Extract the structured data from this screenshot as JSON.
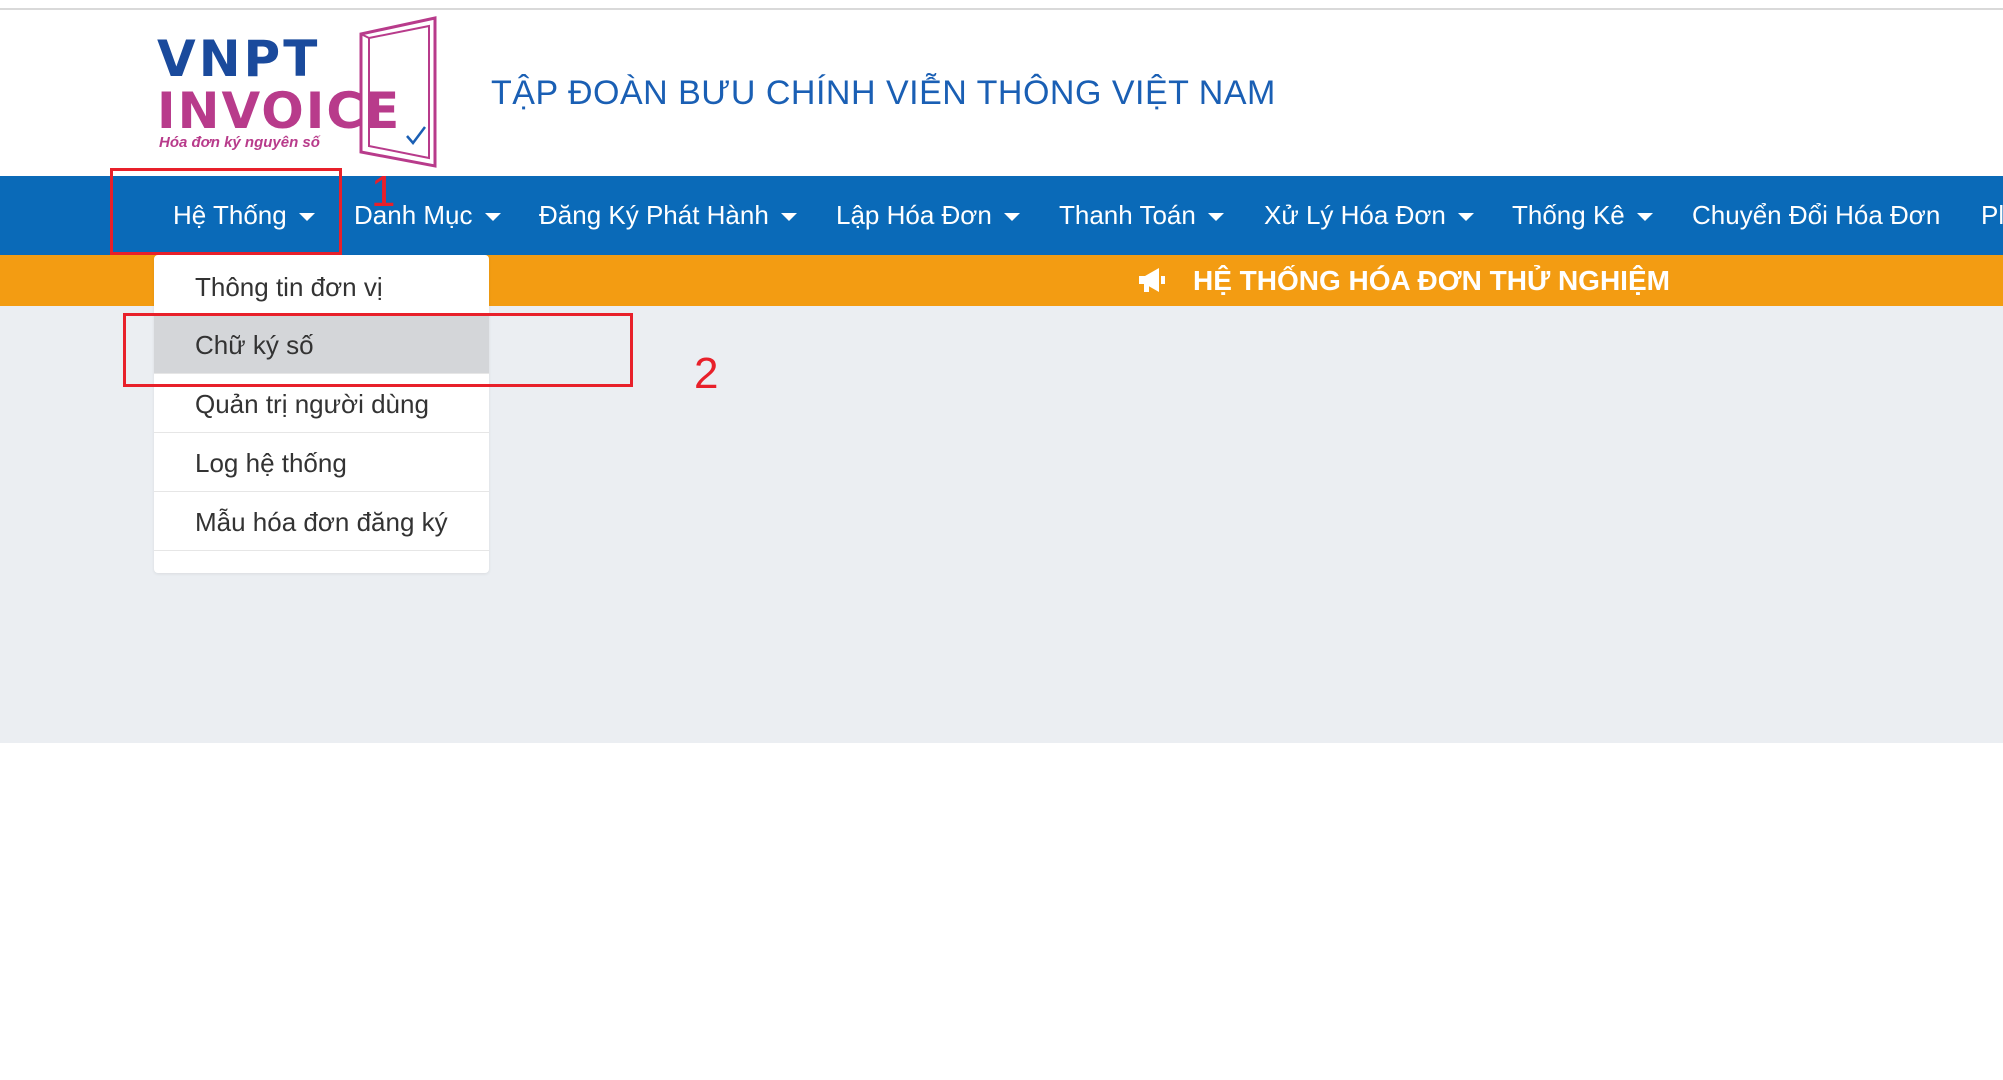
{
  "header": {
    "logo_line1": "VNPT",
    "logo_line2": "INVOICE",
    "logo_tagline": "Hóa đơn ký nguyên số",
    "org_title": "TẬP  ĐOÀN BƯU CHÍNH VIỄN THÔNG VIỆT NAM"
  },
  "nav": {
    "items": [
      {
        "label": "Hệ Thống"
      },
      {
        "label": "Danh Mục"
      },
      {
        "label": "Đăng Ký Phát Hành"
      },
      {
        "label": "Lập Hóa Đơn"
      },
      {
        "label": "Thanh Toán"
      },
      {
        "label": "Xử Lý Hóa Đơn"
      },
      {
        "label": "Thống Kê"
      },
      {
        "label": "Chuyển Đổi Hóa Đơn"
      },
      {
        "label": "Pl"
      }
    ]
  },
  "banner": {
    "icon": "megaphone-icon",
    "text": "HỆ THỐNG HÓA ĐƠN THỬ NGHIỆM"
  },
  "dropdown": {
    "items": [
      {
        "label": "Thông tin đơn vị"
      },
      {
        "label": "Chữ ký số"
      },
      {
        "label": "Quản trị người dùng"
      },
      {
        "label": "Log hệ thống"
      },
      {
        "label": "Mẫu hóa đơn đăng ký"
      }
    ],
    "active_index": 1
  },
  "annotations": {
    "marker_1": "1",
    "marker_2": "2",
    "color": "#e8202a"
  },
  "colors": {
    "nav_bg": "#0a6ab8",
    "banner_bg": "#f39c12",
    "brand_blue": "#1a4a9c",
    "brand_magenta": "#b83b8b"
  }
}
